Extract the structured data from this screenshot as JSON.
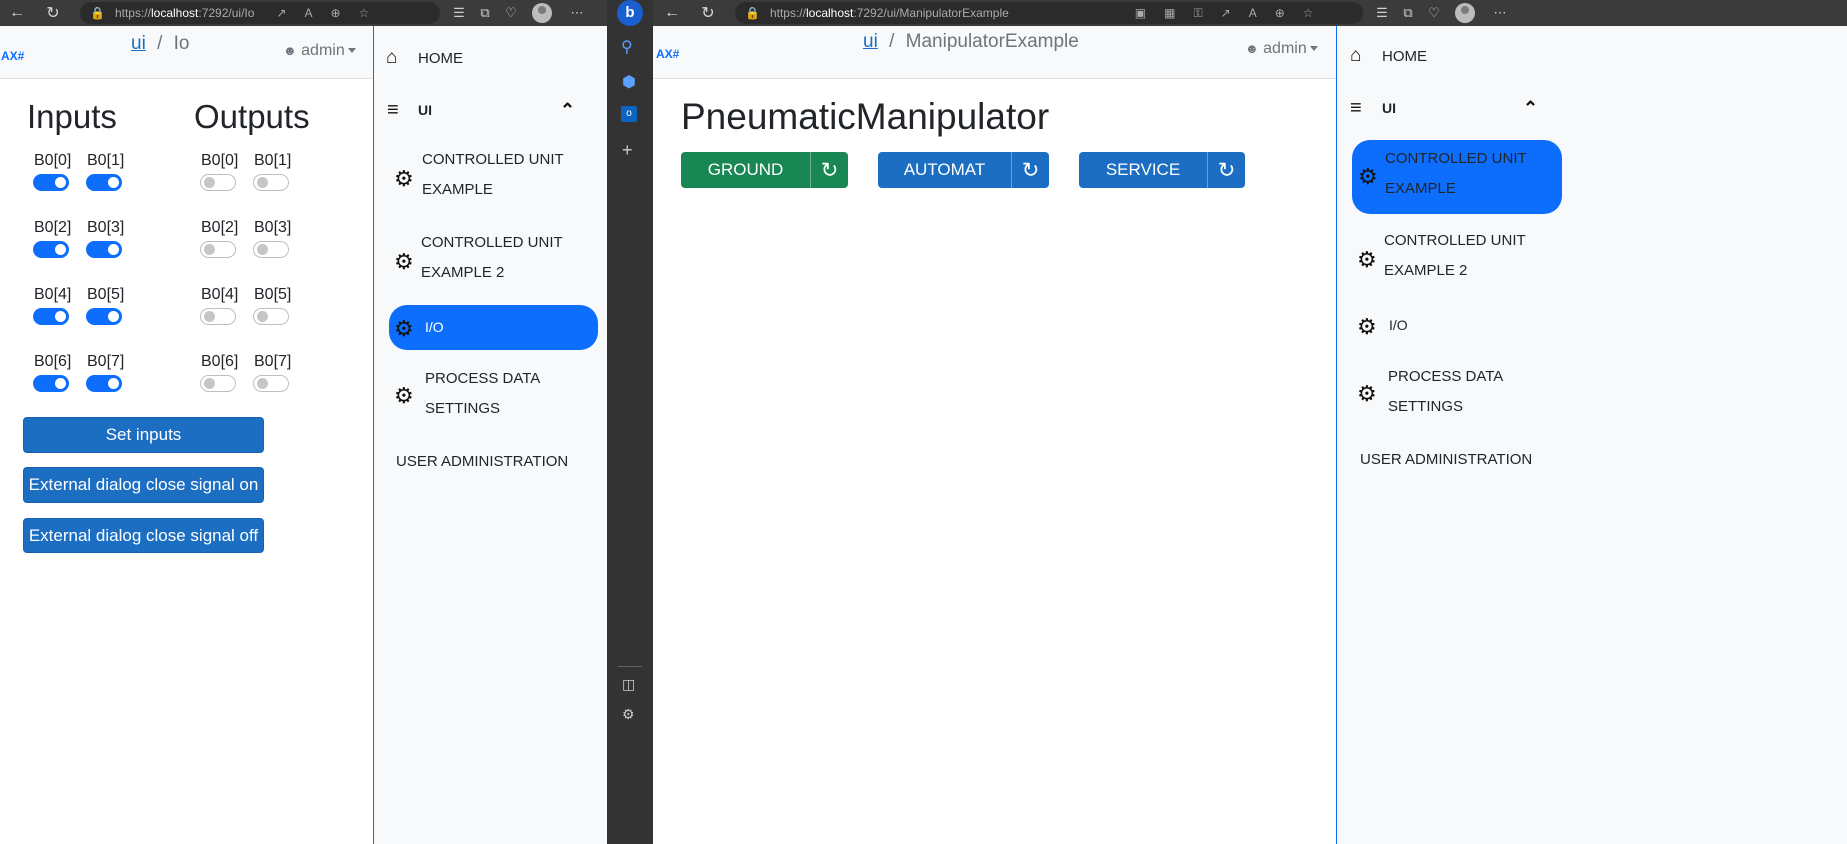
{
  "left_browser": {
    "url_prefix": "https://",
    "url_host": "localhost",
    "url_rest": ":7292/ui/Io"
  },
  "right_browser": {
    "url_prefix": "https://",
    "url_host": "localhost",
    "url_rest": ":7292/ui/ManipulatorExample"
  },
  "left_app": {
    "brand": "AX#",
    "breadcrumb_root": "ui",
    "breadcrumb_sep": "/",
    "breadcrumb_page": "Io",
    "user": "admin",
    "inputs_title": "Inputs",
    "outputs_title": "Outputs",
    "inputs": [
      {
        "label": "B0[0]",
        "on": true
      },
      {
        "label": "B0[1]",
        "on": true
      },
      {
        "label": "B0[2]",
        "on": true
      },
      {
        "label": "B0[3]",
        "on": true
      },
      {
        "label": "B0[4]",
        "on": true
      },
      {
        "label": "B0[5]",
        "on": true
      },
      {
        "label": "B0[6]",
        "on": true
      },
      {
        "label": "B0[7]",
        "on": true
      }
    ],
    "outputs": [
      {
        "label": "B0[0]",
        "on": false
      },
      {
        "label": "B0[1]",
        "on": false
      },
      {
        "label": "B0[2]",
        "on": false
      },
      {
        "label": "B0[3]",
        "on": false
      },
      {
        "label": "B0[4]",
        "on": false
      },
      {
        "label": "B0[5]",
        "on": false
      },
      {
        "label": "B0[6]",
        "on": false
      },
      {
        "label": "B0[7]",
        "on": false
      }
    ],
    "buttons": [
      "Set inputs",
      "External dialog close signal on",
      "External dialog close signal off"
    ]
  },
  "left_nav": {
    "home": "HOME",
    "ui": "UI",
    "items": [
      {
        "line1": "CONTROLLED UNIT",
        "line2": "EXAMPLE"
      },
      {
        "line1": "CONTROLLED UNIT",
        "line2": "EXAMPLE 2"
      },
      {
        "line1": "I/O",
        "line2": ""
      },
      {
        "line1": "PROCESS DATA",
        "line2": "SETTINGS"
      }
    ],
    "user_admin": "USER ADMINISTRATION",
    "active_index": 2
  },
  "right_app": {
    "brand": "AX#",
    "breadcrumb_root": "ui",
    "breadcrumb_sep": "/",
    "breadcrumb_page": "ManipulatorExample",
    "user": "admin",
    "title": "PneumaticManipulator",
    "groups": [
      {
        "label": "GROUND",
        "color": "#198754"
      },
      {
        "label": "AUTOMAT",
        "color": "#1b6ec2"
      },
      {
        "label": "SERVICE",
        "color": "#1b6ec2"
      }
    ]
  },
  "right_nav": {
    "home": "HOME",
    "ui": "UI",
    "items": [
      {
        "line1": "CONTROLLED UNIT",
        "line2": "EXAMPLE"
      },
      {
        "line1": "CONTROLLED UNIT",
        "line2": "EXAMPLE 2"
      },
      {
        "line1": "I/O",
        "line2": ""
      },
      {
        "line1": "PROCESS DATA",
        "line2": "SETTINGS"
      }
    ],
    "user_admin": "USER ADMINISTRATION",
    "active_index": 0
  },
  "icons": {
    "back": "back-arrow-icon",
    "refresh": "refresh-icon",
    "lock": "lock-icon",
    "home": "home-icon",
    "menu": "list-icon",
    "gear": "gear-icon",
    "chevron": "chevron-up-icon",
    "user": "person-icon",
    "search": "search-icon"
  }
}
